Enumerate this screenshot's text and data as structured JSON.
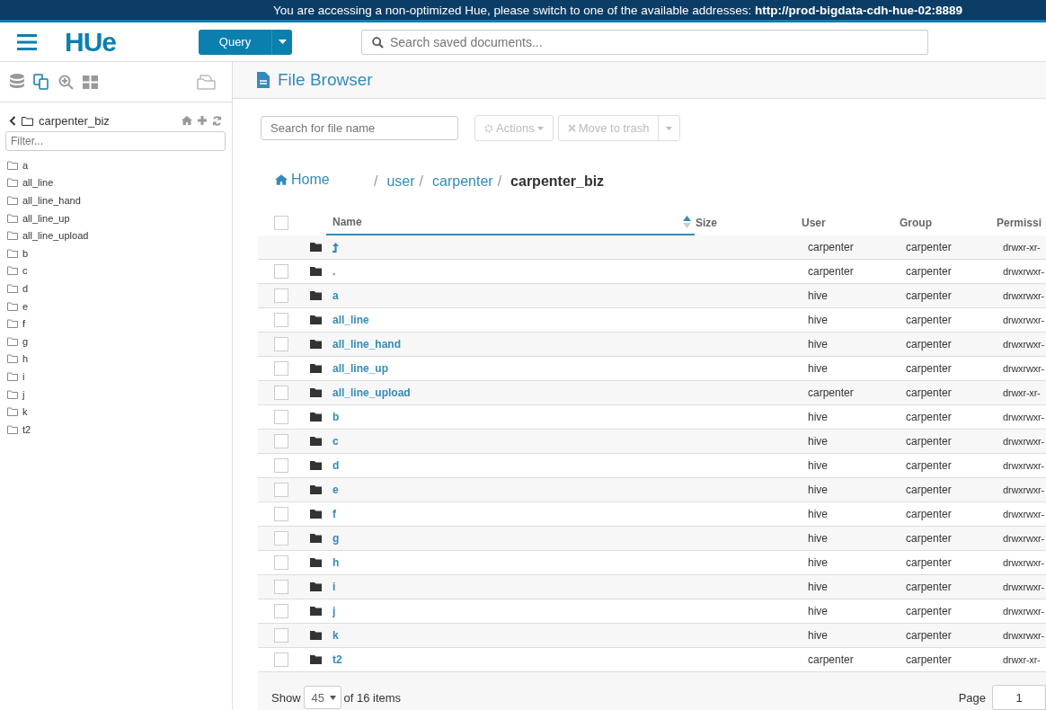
{
  "banner": {
    "text": "You are accessing a non-optimized Hue, please switch to one of the available addresses: ",
    "link": "http://prod-bigdata-cdh-hue-02:8889"
  },
  "header": {
    "logo": "HUe",
    "query_button": "Query",
    "search": {
      "placeholder": "Search saved documents..."
    }
  },
  "sidebar": {
    "path": "carpenter_biz",
    "filter": {
      "placeholder": "Filter..."
    },
    "items": [
      "a",
      "all_line",
      "all_line_hand",
      "all_line_up",
      "all_line_upload",
      "b",
      "c",
      "d",
      "e",
      "f",
      "g",
      "h",
      "i",
      "j",
      "k",
      "t2"
    ]
  },
  "page": {
    "title": "File Browser",
    "search": {
      "placeholder": "Search for file name"
    },
    "actions": "Actions",
    "trash": "Move to trash",
    "breadcrumb": {
      "home": "Home",
      "items": [
        {
          "kind": "separator",
          "text": "/"
        },
        {
          "kind": "link",
          "text": "user"
        },
        {
          "kind": "separator",
          "text": "/"
        },
        {
          "kind": "link",
          "text": "carpenter"
        },
        {
          "kind": "separator",
          "text": "/"
        },
        {
          "kind": "current",
          "text": "carpenter_biz"
        }
      ]
    }
  },
  "table": {
    "columns": [
      "Name",
      "Size",
      "User",
      "Group",
      "Permissi"
    ],
    "all_checked": false,
    "rows": [
      {
        "kind": "parent",
        "user": "carpenter",
        "group": "carpenter",
        "perm": "drwxr-xr-"
      },
      {
        "kind": "folder",
        "name": ".",
        "checked": false,
        "user": "carpenter",
        "group": "carpenter",
        "perm": "drwxrwxr-"
      },
      {
        "kind": "folder",
        "name": "a",
        "checked": false,
        "user": "hive",
        "group": "carpenter",
        "perm": "drwxrwxr-"
      },
      {
        "kind": "folder",
        "name": "all_line",
        "checked": false,
        "user": "hive",
        "group": "carpenter",
        "perm": "drwxrwxr-"
      },
      {
        "kind": "folder",
        "name": "all_line_hand",
        "checked": false,
        "user": "hive",
        "group": "carpenter",
        "perm": "drwxrwxr-"
      },
      {
        "kind": "folder",
        "name": "all_line_up",
        "checked": false,
        "user": "hive",
        "group": "carpenter",
        "perm": "drwxrwxr-"
      },
      {
        "kind": "folder",
        "name": "all_line_upload",
        "checked": false,
        "user": "carpenter",
        "group": "carpenter",
        "perm": "drwxr-xr-"
      },
      {
        "kind": "folder",
        "name": "b",
        "checked": false,
        "user": "hive",
        "group": "carpenter",
        "perm": "drwxrwxr-"
      },
      {
        "kind": "folder",
        "name": "c",
        "checked": false,
        "user": "hive",
        "group": "carpenter",
        "perm": "drwxrwxr-"
      },
      {
        "kind": "folder",
        "name": "d",
        "checked": false,
        "user": "hive",
        "group": "carpenter",
        "perm": "drwxrwxr-"
      },
      {
        "kind": "folder",
        "name": "e",
        "checked": false,
        "user": "hive",
        "group": "carpenter",
        "perm": "drwxrwxr-"
      },
      {
        "kind": "folder",
        "name": "f",
        "checked": false,
        "user": "hive",
        "group": "carpenter",
        "perm": "drwxrwxr-"
      },
      {
        "kind": "folder",
        "name": "g",
        "checked": false,
        "user": "hive",
        "group": "carpenter",
        "perm": "drwxrwxr-"
      },
      {
        "kind": "folder",
        "name": "h",
        "checked": false,
        "user": "hive",
        "group": "carpenter",
        "perm": "drwxrwxr-"
      },
      {
        "kind": "folder",
        "name": "i",
        "checked": false,
        "user": "hive",
        "group": "carpenter",
        "perm": "drwxrwxr-"
      },
      {
        "kind": "folder",
        "name": "j",
        "checked": false,
        "user": "hive",
        "group": "carpenter",
        "perm": "drwxrwxr-"
      },
      {
        "kind": "folder",
        "name": "k",
        "checked": false,
        "user": "hive",
        "group": "carpenter",
        "perm": "drwxrwxr-"
      },
      {
        "kind": "folder",
        "name": "t2",
        "checked": false,
        "user": "carpenter",
        "group": "carpenter",
        "perm": "drwxr-xr-"
      }
    ]
  },
  "footer": {
    "show": "Show",
    "page_size": "45",
    "of_items": "of 16 items",
    "page_label": "Page",
    "page": "1"
  }
}
